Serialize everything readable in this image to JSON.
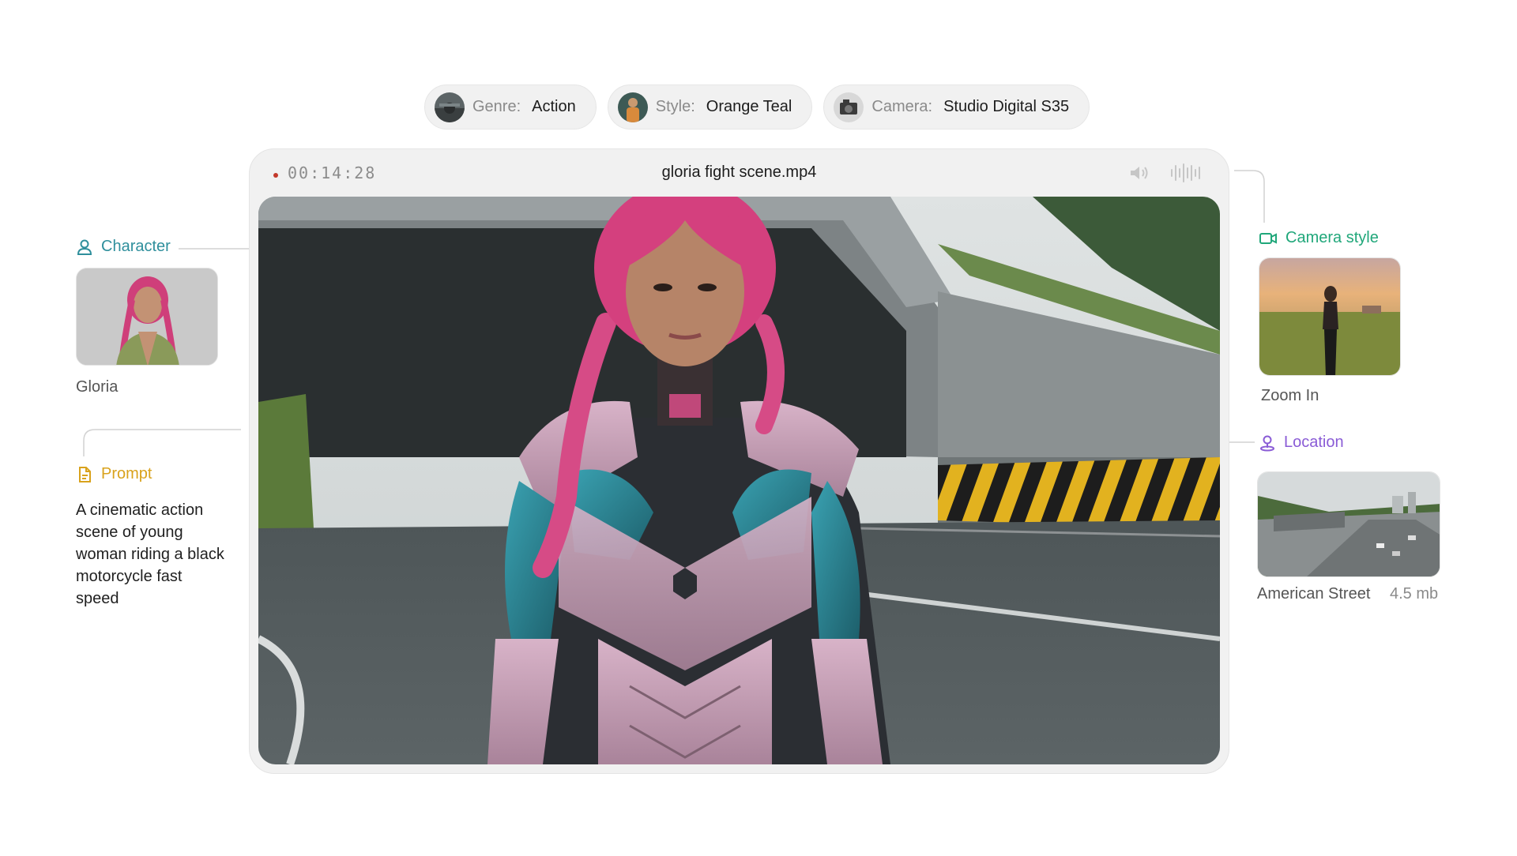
{
  "chips": [
    {
      "key": "Genre:",
      "value": "Action",
      "icon": "genre-thumbnail"
    },
    {
      "key": "Style:",
      "value": "Orange Teal",
      "icon": "style-thumbnail"
    },
    {
      "key": "Camera:",
      "value": "Studio Digital S35",
      "icon": "camera-thumbnail"
    }
  ],
  "player": {
    "timecode": "00:14:28",
    "filename": "gloria fight scene.mp4",
    "icons": [
      "volume-icon",
      "waveform-icon"
    ]
  },
  "character": {
    "label": "Character",
    "name": "Gloria",
    "icon": "user-icon"
  },
  "prompt": {
    "label": "Prompt",
    "text": "A cinematic action scene of young woman riding a black motorcycle fast speed",
    "icon": "document-icon"
  },
  "camera_style": {
    "label": "Camera style",
    "value": "Zoom In",
    "icon": "video-camera-icon"
  },
  "location": {
    "label": "Location",
    "name": "American Street",
    "size": "4.5 mb",
    "icon": "map-pin-icon"
  },
  "colors": {
    "teal": "#2f8f9c",
    "green": "#20a77a",
    "purple": "#8a5cd6",
    "amber": "#d9a21c",
    "rec": "#c3392b"
  }
}
